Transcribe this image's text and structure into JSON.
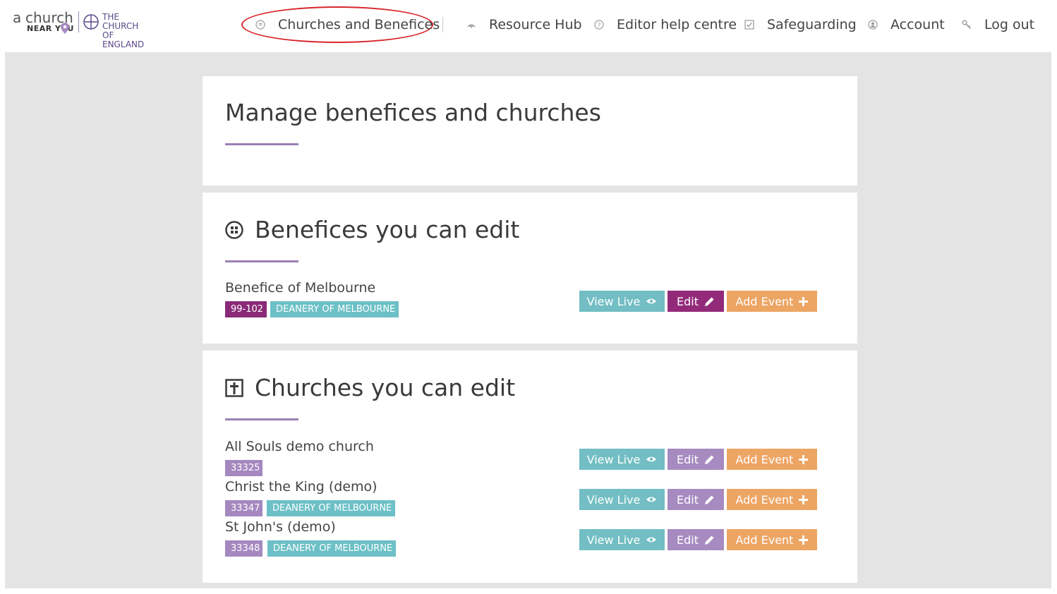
{
  "header": {
    "logo": {
      "a": "a",
      "church": "church",
      "near": "NEAR Y",
      "near_o": "U",
      "coe_line1": "THE CHURCH",
      "coe_line2": "OF ENGLAND"
    },
    "nav": [
      {
        "label": "Churches and Benefices",
        "icon": "list-icon"
      },
      {
        "label": "Resource Hub",
        "icon": "signal-icon"
      },
      {
        "label": "Editor help centre",
        "icon": "question-icon"
      },
      {
        "label": "Safeguarding",
        "icon": "checkbox-icon"
      },
      {
        "label": "Account",
        "icon": "user-icon"
      },
      {
        "label": "Log out",
        "icon": "key-icon"
      }
    ],
    "highlight_color": "#d8262b"
  },
  "page": {
    "title": "Manage benefices and churches"
  },
  "benefices": {
    "title": "Benefices you can edit",
    "icon": "grid-circle-icon",
    "items": [
      {
        "name": "Benefice of Melbourne",
        "id": "99-102",
        "deanery": "DEANERY OF MELBOURNE"
      }
    ]
  },
  "churches": {
    "title": "Churches you can edit",
    "icon": "cross-box-icon",
    "items": [
      {
        "name": "All Souls demo church",
        "id": "33325",
        "deanery": ""
      },
      {
        "name": "Christ the King (demo)",
        "id": "33347",
        "deanery": "DEANERY OF MELBOURNE"
      },
      {
        "name": "St John's (demo)",
        "id": "33348",
        "deanery": "DEANERY OF MELBOURNE"
      }
    ]
  },
  "buttons": {
    "view_live": "View Live",
    "edit": "Edit",
    "add_event": "Add Event"
  },
  "colors": {
    "purple_accent": "#9b80b5",
    "teal": "#72bec4",
    "orange": "#eda564",
    "edit_dark": "#932a79",
    "edit_light": "#a78ac0"
  }
}
